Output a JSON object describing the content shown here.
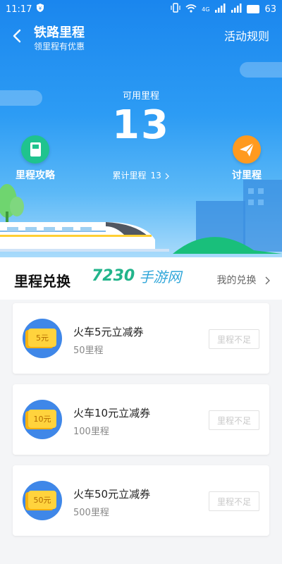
{
  "status_bar": {
    "time": "11:17",
    "network": "4G",
    "battery": "63"
  },
  "header": {
    "title": "铁路里程",
    "subtitle": "领里程有优惠",
    "rules_label": "活动规则"
  },
  "summary": {
    "available_label": "可用里程",
    "available_value": "13",
    "accumulated_label": "累计里程",
    "accumulated_value": "13",
    "left_action_label": "里程攻略",
    "right_action_label": "讨里程"
  },
  "exchange": {
    "title": "里程兑换",
    "my_exchange_label": "我的兑换",
    "watermark_num": "7230",
    "watermark_text": "手游网",
    "items": [
      {
        "ticket": "5元",
        "name": "火车5元立减券",
        "miles": "50里程",
        "button": "里程不足"
      },
      {
        "ticket": "10元",
        "name": "火车10元立减券",
        "miles": "100里程",
        "button": "里程不足"
      },
      {
        "ticket": "50元",
        "name": "火车50元立减券",
        "miles": "500里程",
        "button": "里程不足"
      }
    ]
  },
  "colors": {
    "hero_top": "#1a86ee",
    "strategy_green": "#1fc38e",
    "ask_orange": "#ff9a1f",
    "coupon_yellow": "#ffd33d"
  },
  "icons": {
    "back": "chevron-left-icon",
    "strategy": "book-icon",
    "ask": "paper-plane-icon",
    "accumulated_chevron": "chevron-right-icon",
    "my_exchange_chevron": "chevron-right-icon",
    "coupon": "ticket-icon"
  }
}
